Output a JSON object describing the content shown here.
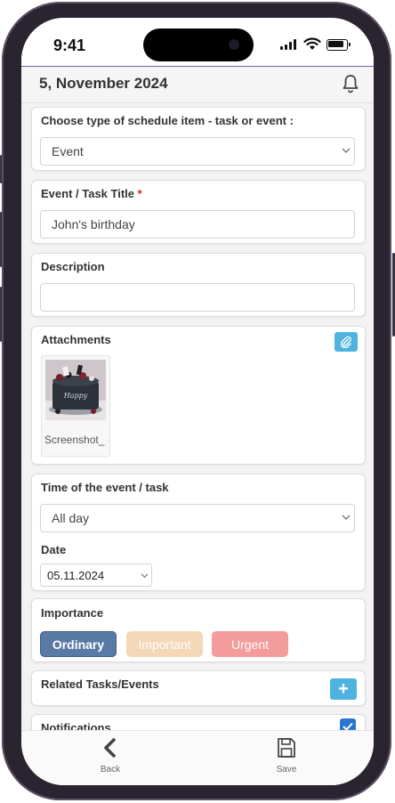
{
  "status_bar": {
    "time": "9:41"
  },
  "header": {
    "date_title": "5, November 2024",
    "notification_icon": "bell-icon"
  },
  "schedule_type": {
    "label": "Choose type of schedule item - task or event :",
    "selected": "Event"
  },
  "title_field": {
    "label": "Event / Task Title",
    "required_mark": "*",
    "value": "John's birthday"
  },
  "description_field": {
    "label": "Description",
    "value": ""
  },
  "attachments": {
    "label": "Attachments",
    "attach_icon": "paperclip-icon",
    "files": [
      {
        "name": "Screenshot_",
        "thumbnail": "birthday-cake-photo"
      }
    ]
  },
  "time_section": {
    "label": "Time of the event / task",
    "selected": "All day",
    "date_label": "Date",
    "date_value": "05.11.2024"
  },
  "importance": {
    "label": "Importance",
    "options": [
      {
        "label": "Ordinary",
        "color": "#5a7aa6",
        "selected": true
      },
      {
        "label": "Important",
        "color": "#f3d7b6",
        "selected": false
      },
      {
        "label": "Urgent",
        "color": "#f49b9c",
        "selected": false
      }
    ]
  },
  "related": {
    "label": "Related Tasks/Events",
    "add_label": "+"
  },
  "notifications": {
    "label": "Notifications",
    "checked": true
  },
  "bottom_nav": {
    "back_label": "Back",
    "save_label": "Save"
  },
  "colors": {
    "accent": "#4fb3e0",
    "header_border": "#6f5fb0",
    "checkbox": "#2a76cf"
  }
}
